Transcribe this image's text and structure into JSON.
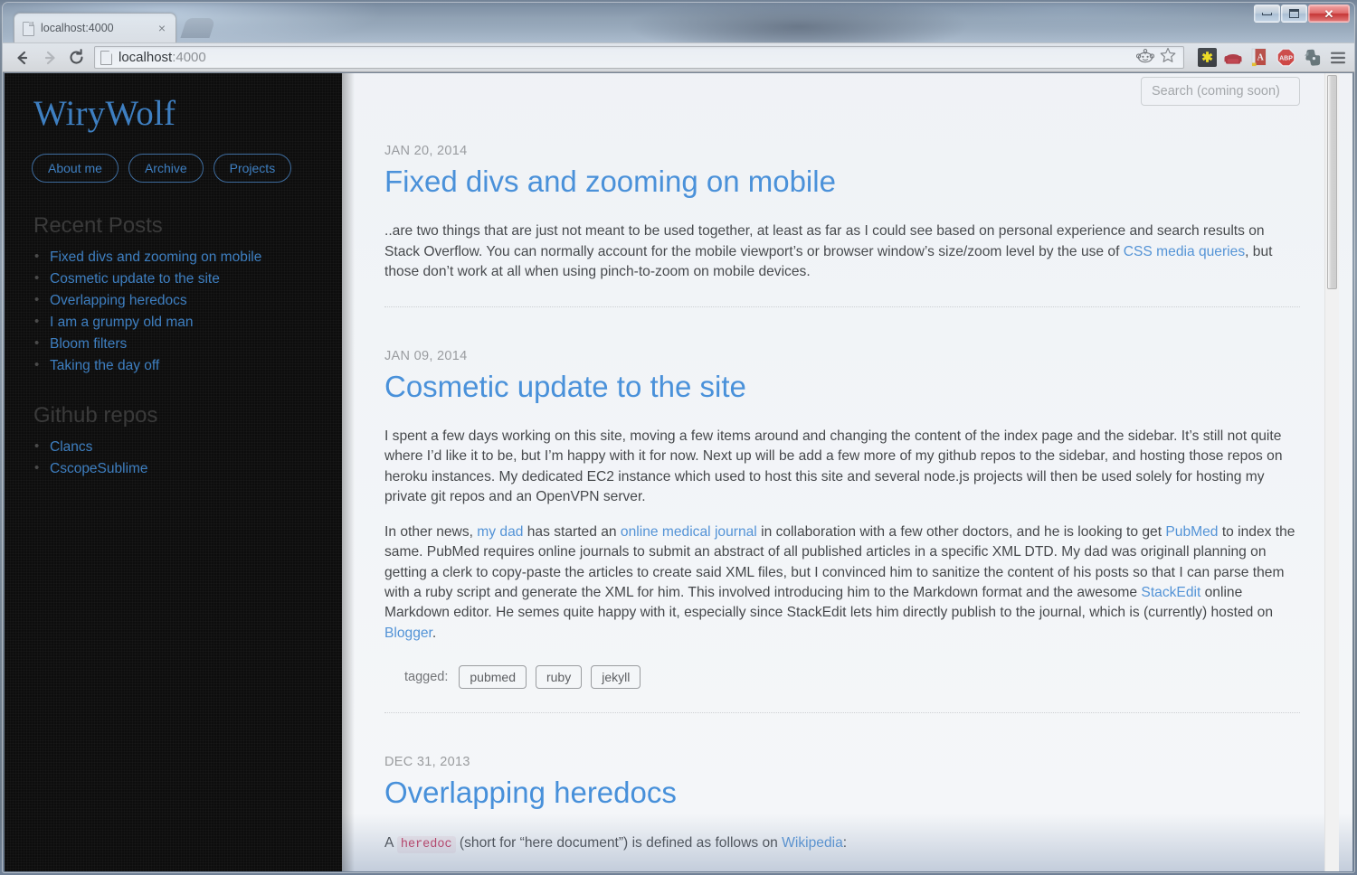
{
  "window": {
    "minimize_label": "Minimize",
    "maximize_label": "Maximize",
    "close_label": "✕"
  },
  "browser": {
    "tab": {
      "title": "localhost:4000",
      "close_label": "×",
      "favicon": "document-icon"
    },
    "new_tab_label": "",
    "back_label": "←",
    "forward_label": "→",
    "reload_label": "⟳",
    "omnibox": {
      "value_host": "localhost",
      "value_port": ":4000",
      "favicon": "document-icon"
    },
    "omnibox_icons": [
      "reddit-icon",
      "bookmark-star-icon"
    ],
    "extensions": [
      {
        "name": "asterisk-extension-icon",
        "glyph": "✱",
        "color": "#ffe500",
        "bg": "#2b2b2b"
      },
      {
        "name": "couch-extension-icon",
        "glyph": "",
        "color": "#b4232a",
        "bg": "transparent"
      },
      {
        "name": "red-book-extension-icon",
        "glyph": "A",
        "color": "#ffffff",
        "bg": "#c0392b"
      },
      {
        "name": "adblock-plus-icon",
        "glyph": "ABP",
        "color": "#ffffff",
        "bg": "#d9332b"
      },
      {
        "name": "evernote-extension-icon",
        "glyph": "",
        "color": "#5d6b6b",
        "bg": "transparent"
      },
      {
        "name": "chrome-menu-icon",
        "glyph": "≡",
        "color": "#5a5a5a",
        "bg": "transparent"
      }
    ]
  },
  "sidebar": {
    "site_title": "WiryWolf",
    "nav": [
      {
        "label": "About me",
        "name": "nav-about-me"
      },
      {
        "label": "Archive",
        "name": "nav-archive"
      },
      {
        "label": "Projects",
        "name": "nav-projects"
      }
    ],
    "recent_posts_heading": "Recent Posts",
    "recent_posts": [
      "Fixed divs and zooming on mobile",
      "Cosmetic update to the site",
      "Overlapping heredocs",
      "I am a grumpy old man",
      "Bloom filters",
      "Taking the day off"
    ],
    "github_heading": "Github repos",
    "github_repos": [
      "Clancs",
      "CscopeSublime"
    ]
  },
  "search": {
    "placeholder": "Search (coming soon)",
    "value": ""
  },
  "posts": [
    {
      "date": "JAN 20, 2014",
      "title": "Fixed divs and zooming on mobile",
      "paragraphs": [
        {
          "parts": [
            {
              "t": "..are two things that are just not meant to be used together, at least as far as I could see based on personal experience and search results on Stack Overflow. You can normally account for the mobile viewport’s or browser window’s size/zoom level by the use of "
            },
            {
              "t": "CSS media queries",
              "link": true
            },
            {
              "t": ", but those don’t work at all when using pinch-to-zoom on mobile devices."
            }
          ]
        }
      ],
      "tags_label": "",
      "tags": []
    },
    {
      "date": "JAN 09, 2014",
      "title": "Cosmetic update to the site",
      "paragraphs": [
        {
          "parts": [
            {
              "t": "I spent a few days working on this site, moving a few items around and changing the content of the index page and the sidebar. It’s still not quite where I’d like it to be, but I’m happy with it for now. Next up will be add a few more of my github repos to the sidebar, and hosting those repos on heroku instances. My dedicated EC2 instance which used to host this site and several node.js projects will then be used solely for hosting my private git repos and an OpenVPN server."
            }
          ]
        },
        {
          "parts": [
            {
              "t": "In other news, "
            },
            {
              "t": "my dad",
              "link": true
            },
            {
              "t": " has started an "
            },
            {
              "t": "online medical journal",
              "link": true
            },
            {
              "t": " in collaboration with a few other doctors, and he is looking to get "
            },
            {
              "t": "PubMed",
              "link": true
            },
            {
              "t": " to index the same. PubMed requires online journals to submit an abstract of all published articles in a specific XML DTD. My dad was originall planning on getting a clerk to copy-paste the articles to create said XML files, but I convinced him to sanitize the content of his posts so that I can parse them with a ruby script and generate the XML for him. This involved introducing him to the Markdown format and the awesome "
            },
            {
              "t": "StackEdit",
              "link": true
            },
            {
              "t": " online Markdown editor. He semes quite happy with it, especially since StackEdit lets him directly publish to the journal, which is (currently) hosted on "
            },
            {
              "t": "Blogger",
              "link": true
            },
            {
              "t": "."
            }
          ]
        }
      ],
      "tags_label": "tagged:",
      "tags": [
        "pubmed",
        "ruby",
        "jekyll"
      ]
    },
    {
      "date": "DEC 31, 2013",
      "title": "Overlapping heredocs",
      "paragraphs": [
        {
          "parts": [
            {
              "t": "A "
            },
            {
              "t": "heredoc",
              "code": true
            },
            {
              "t": " (short for “here document”) is defined as follows on "
            },
            {
              "t": "Wikipedia",
              "link": true
            },
            {
              "t": ":"
            }
          ]
        }
      ],
      "tags_label": "",
      "tags": []
    }
  ],
  "colors": {
    "link_blue": "#4a90d9",
    "title_blue": "#3e8ddd",
    "sidebar_bg": "#0d0d0d",
    "sidebar_link": "#3e7fc1",
    "code_red": "#c7254e"
  }
}
